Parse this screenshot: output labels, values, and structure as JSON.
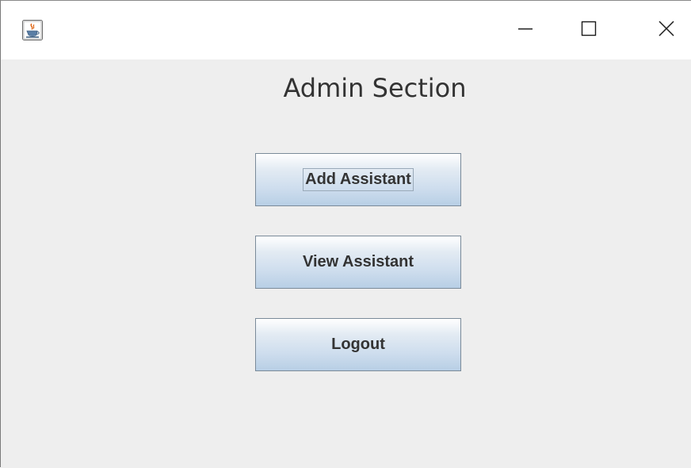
{
  "window": {
    "icon": "java-cup-icon",
    "controls": {
      "minimize": "minimize-icon",
      "maximize": "maximize-icon",
      "close": "close-icon"
    }
  },
  "main": {
    "title": "Admin Section",
    "buttons": {
      "add": "Add Assistant",
      "view": "View Assistant",
      "logout": "Logout"
    },
    "focused_button": "Add Assistant"
  },
  "colors": {
    "content_background": "#eeeeee",
    "titlebar_background": "#ffffff",
    "button_border": "#7a8a99",
    "text": "#333333"
  }
}
